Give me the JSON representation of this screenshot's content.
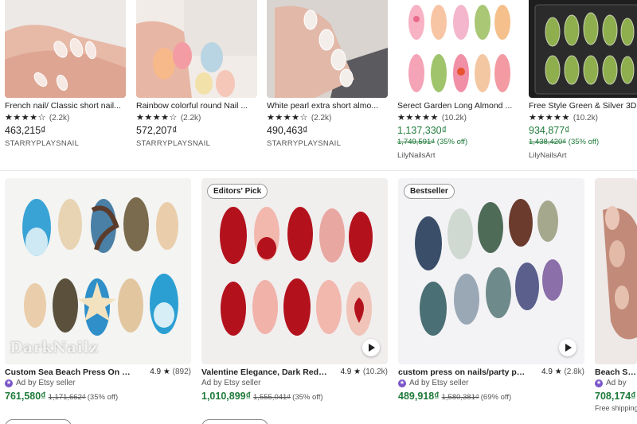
{
  "row1": [
    {
      "title": "French nail/ Classic short nail...",
      "rating_count": "(2.2k)",
      "stars": 4.5,
      "price": "463,215₫",
      "sale": false,
      "shop": "STARRYPLAYSNAIL"
    },
    {
      "title": "Rainbow colorful round Nail ...",
      "rating_count": "(2.2k)",
      "stars": 4.5,
      "price": "572,207₫",
      "sale": false,
      "shop": "STARRYPLAYSNAIL"
    },
    {
      "title": "White pearl extra short almo...",
      "rating_count": "(2.2k)",
      "stars": 4.5,
      "price": "490,463₫",
      "sale": false,
      "shop": "STARRYPLAYSNAIL"
    },
    {
      "title": "Serect Garden Long Almond ...",
      "rating_count": "(10.2k)",
      "stars": 5,
      "price": "1,137,330₫",
      "sale": true,
      "original": "1,749,591₫",
      "discount": "(35% off)",
      "shop": "LilyNailsArt"
    },
    {
      "title": "Free Style Green & Silver 3D...",
      "rating_count": "(10.2k)",
      "stars": 5,
      "price": "934,877₫",
      "sale": true,
      "original": "1,438,420₫",
      "discount": "(35% off)",
      "shop": "LilyNailsArt"
    }
  ],
  "row2": [
    {
      "title": "Custom Sea Beach Press On Nail...",
      "rating": "4.9",
      "star": "★",
      "rating_count": "(892)",
      "ad": "Ad by Etsy seller",
      "price": "761,580₫",
      "original": "1,171,662₫",
      "discount": "(35% off)",
      "badge": "",
      "watermark": "DarkNailz",
      "video": false
    },
    {
      "title": "Valentine Elegance, Dark Red Pr...",
      "rating": "4.9",
      "star": "★",
      "rating_count": "(10.2k)",
      "ad": "Ad by Etsy seller",
      "price": "1,010,899₫",
      "original": "1,555,041₫",
      "discount": "(35% off)",
      "badge": "Editors' Pick",
      "video": true
    },
    {
      "title": "custom press on nails/party pres...",
      "rating": "4.9",
      "star": "★",
      "rating_count": "(2.8k)",
      "ad": "Ad by Etsy seller",
      "price": "489,918₫",
      "original": "1,580,381₫",
      "discount": "(69% off)",
      "badge": "Bestseller",
      "video": true
    },
    {
      "title": "Beach Summ",
      "ad": "Ad by",
      "price": "708,174₫",
      "shipping": "Free shipping"
    }
  ],
  "colors": {
    "sale_green": "#1f7a3a",
    "ad_purple": "#7a55c8",
    "divider": "#e6e6e6"
  },
  "icons": {
    "star": "star-icon",
    "play": "play-icon",
    "ad": "ad-icon"
  }
}
